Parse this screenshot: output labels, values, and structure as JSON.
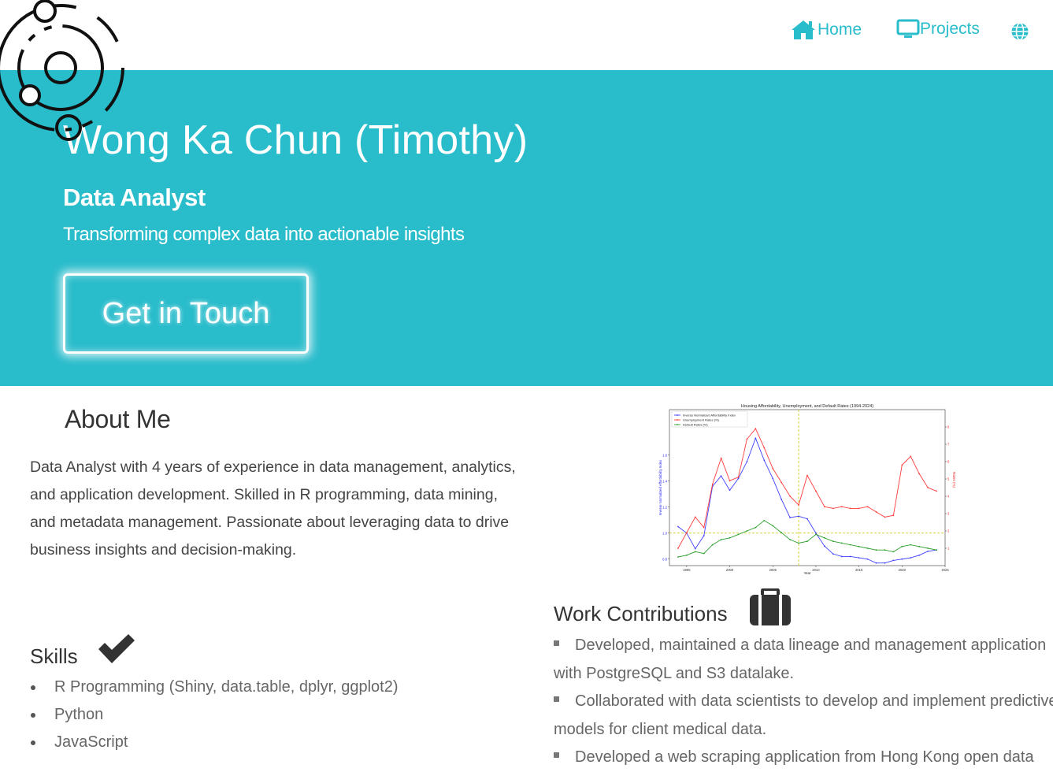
{
  "nav": {
    "home_label": "Home",
    "projects_label": "Projects",
    "accent": "#29bccb"
  },
  "hero": {
    "name": "Wong Ka Chun (Timothy)",
    "role": "Data Analyst",
    "tagline": "Transforming complex data into actionable insights",
    "cta_label": "Get in Touch",
    "background": "#29bccb"
  },
  "about": {
    "title": "About Me",
    "text": "Data Analyst with 4 years of experience in data management, analytics, and application development. Skilled in R programming, data mining, and metadata management. Passionate about leveraging data to drive business insights and decision-making."
  },
  "skills": {
    "title": "Skills",
    "items": [
      "R Programming (Shiny, data.table, dplyr, ggplot2)",
      "Python",
      "JavaScript"
    ]
  },
  "work": {
    "title": "Work Contributions",
    "items": [
      "Developed, maintained a data lineage and management application with PostgreSQL and S3 datalake.",
      "Collaborated with data scientists to develop and implement predictive models for client medical data.",
      "Developed a web scraping application from Hong Kong open data"
    ]
  },
  "chart_data": {
    "type": "line",
    "title": "Housing Affordability, Unemployment, and Default Rates (1994-2024)",
    "xlabel": "Year",
    "ylabel": "Inverse Normalized Affordability Index",
    "y2label": "Rates (%)",
    "xlim": [
      1993,
      2025
    ],
    "ylim": [
      0.75,
      1.95
    ],
    "y2lim": [
      0,
      9
    ],
    "xticks": [
      1995,
      2000,
      2005,
      2010,
      2015,
      2020,
      2025
    ],
    "yticks": [
      0.8,
      1.0,
      1.2,
      1.4,
      1.6
    ],
    "y2ticks": [
      1,
      2,
      3,
      4,
      5,
      6,
      7,
      8
    ],
    "legend_position": "top-left",
    "reference_lines": {
      "x": 2008,
      "y": 1.0
    },
    "x": [
      1994,
      1995,
      1996,
      1997,
      1998,
      1999,
      2000,
      2001,
      2002,
      2003,
      2004,
      2005,
      2006,
      2007,
      2008,
      2009,
      2010,
      2011,
      2012,
      2013,
      2014,
      2015,
      2016,
      2017,
      2018,
      2019,
      2020,
      2021,
      2022,
      2023,
      2024
    ],
    "series": [
      {
        "name": "Inverse Normalized Affordability Index",
        "color": "#4040ff",
        "axis": "left",
        "values": [
          1.05,
          1.0,
          0.88,
          0.98,
          1.36,
          1.44,
          1.33,
          1.42,
          1.55,
          1.73,
          1.56,
          1.42,
          1.26,
          1.12,
          1.13,
          1.11,
          1.0,
          0.9,
          0.84,
          0.82,
          0.82,
          0.81,
          0.8,
          0.77,
          0.77,
          0.79,
          0.8,
          0.81,
          0.83,
          0.86,
          0.87
        ]
      },
      {
        "name": "Unemployment Rates (%)",
        "color": "#ff3b3b",
        "axis": "right",
        "values": [
          1.0,
          1.9,
          2.8,
          2.2,
          4.7,
          6.2,
          4.9,
          5.1,
          7.3,
          7.9,
          6.8,
          5.6,
          4.8,
          4.0,
          3.5,
          5.2,
          4.3,
          3.4,
          3.3,
          3.4,
          3.3,
          3.3,
          3.4,
          3.1,
          2.8,
          2.9,
          5.8,
          6.3,
          5.3,
          4.5,
          4.3
        ]
      },
      {
        "name": "Default Rates (%)",
        "color": "#2ca02c",
        "axis": "right",
        "values": [
          0.5,
          0.6,
          0.8,
          0.7,
          1.2,
          1.5,
          1.6,
          1.8,
          2.0,
          2.2,
          2.6,
          2.3,
          1.9,
          1.5,
          1.3,
          1.4,
          1.8,
          1.6,
          1.4,
          1.3,
          1.2,
          1.1,
          1.0,
          0.9,
          0.9,
          0.8,
          1.1,
          1.2,
          1.1,
          1.0,
          0.9
        ]
      }
    ]
  }
}
